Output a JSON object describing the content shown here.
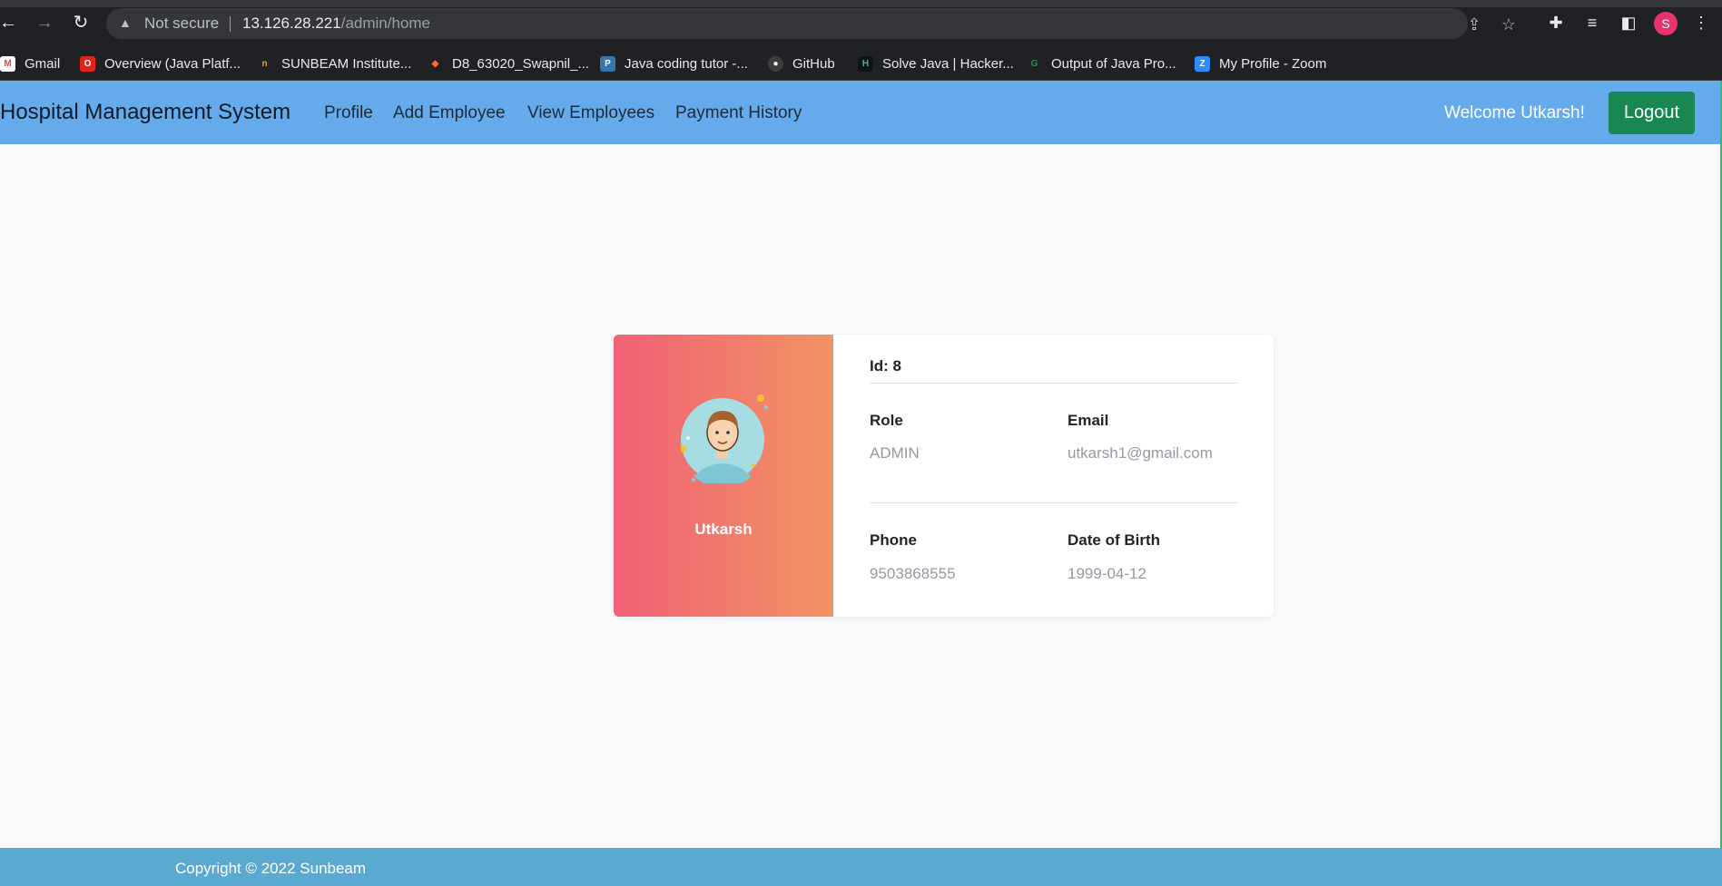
{
  "browser": {
    "not_secure": "Not secure",
    "url_host": "13.126.28.221",
    "url_path": "/admin/home",
    "profile_initial": "S",
    "icons": [
      "back-icon",
      "forward-icon",
      "reload-icon",
      "warning-icon",
      "share-icon",
      "star-icon",
      "extensions-icon",
      "media-icon",
      "sidepanel-icon",
      "menu-icon"
    ]
  },
  "bookmarks": [
    {
      "label": "Gmail",
      "icon": "gmail-icon",
      "color": "#ea4335",
      "glyph": "M"
    },
    {
      "label": "Overview (Java Platf...",
      "icon": "oracle-icon",
      "color": "#e2231a",
      "glyph": "O"
    },
    {
      "label": "SUNBEAM Institute...",
      "icon": "sunbeam-icon",
      "color": "#f29b1d",
      "glyph": "n"
    },
    {
      "label": "D8_63020_Swapnil_...",
      "icon": "gitlab-icon",
      "color": "#fc6d26",
      "glyph": "◆"
    },
    {
      "label": "Java coding tutor -...",
      "icon": "python-icon",
      "color": "#3776ab",
      "glyph": "P"
    },
    {
      "label": "GitHub",
      "icon": "github-icon",
      "color": "#333333",
      "glyph": "●"
    },
    {
      "label": "Solve Java | Hacker...",
      "icon": "hackerrank-icon",
      "color": "#0e141e",
      "glyph": "H"
    },
    {
      "label": "Output of Java Pro...",
      "icon": "geeksforgeeks-icon",
      "color": "#2f8d46",
      "glyph": "G"
    },
    {
      "label": "My Profile - Zoom",
      "icon": "zoom-icon",
      "color": "#2d8cff",
      "glyph": "Z"
    }
  ],
  "navbar": {
    "brand": "Hospital Management System",
    "links": [
      "Profile",
      "Add Employee",
      "View Employees",
      "Payment History"
    ],
    "welcome": "Welcome Utkarsh!",
    "logout": "Logout"
  },
  "profile": {
    "name": "Utkarsh",
    "id_line": "Id: 8",
    "role_label": "Role",
    "role": "ADMIN",
    "email_label": "Email",
    "email": "utkarsh1@gmail.com",
    "phone_label": "Phone",
    "phone": "9503868555",
    "dob_label": "Date of Birth",
    "dob": "1999-04-12"
  },
  "footer": {
    "copyright": "Copyright © 2022 Sunbeam"
  },
  "colors": {
    "navbar": "#65abeb",
    "logout": "#198754",
    "card_gradient_start": "#f06176",
    "card_gradient_end": "#f29363",
    "footer": "#5aa9d0"
  }
}
